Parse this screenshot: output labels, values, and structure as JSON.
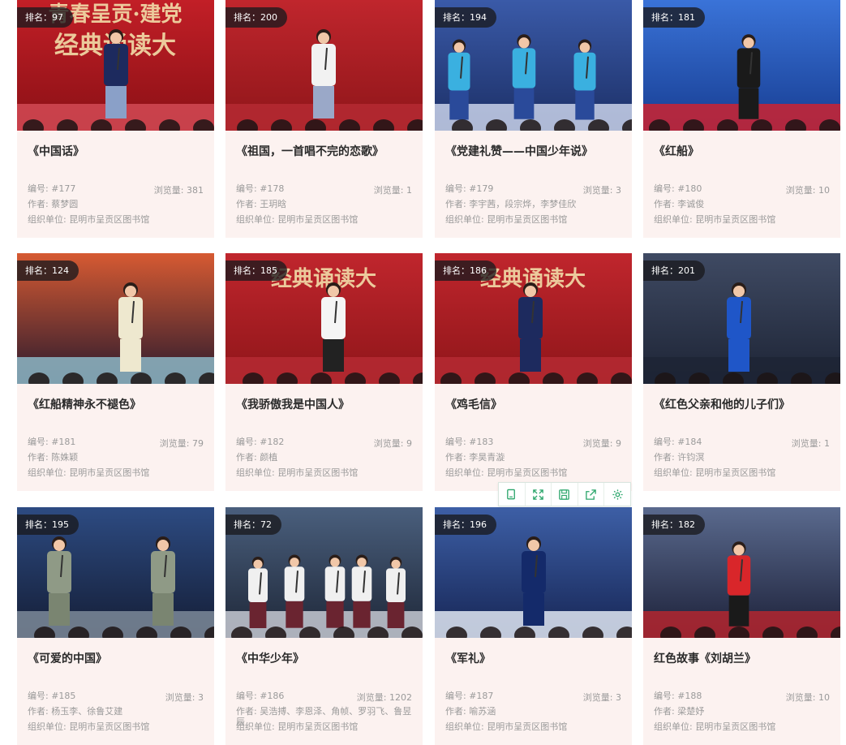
{
  "rank_prefix": "排名：",
  "labels": {
    "number": "编号: ",
    "views": "浏览量: ",
    "author": "作者: ",
    "org": "组织单位: "
  },
  "colors": {
    "card_bg": "#fcf2f0",
    "accent_green": "#2aa56a",
    "stage_red": "#c8242c"
  },
  "toolbar": [
    "copy-icon",
    "expand-icon",
    "save-icon",
    "share-icon",
    "gear-icon"
  ],
  "cards": [
    {
      "rank": "97",
      "title": "《中国话》",
      "number": "#177",
      "views": "381",
      "author": "蔡梦圆",
      "org": "昆明市呈贡区图书馆",
      "backdrop_text": "青春呈贡·建党",
      "backdrop_text2": "经典诵读大"
    },
    {
      "rank": "200",
      "title": "《祖国，一首唱不完的恋歌》",
      "number": "#178",
      "views": "1",
      "author": "王玥晗",
      "org": "昆明市呈贡区图书馆",
      "backdrop_text": "",
      "backdrop_text2": ""
    },
    {
      "rank": "194",
      "title": "《党建礼赞——中国少年说》",
      "number": "#179",
      "views": "3",
      "author": "李宇茜，段宗烨，李梦佳欣",
      "org": "昆明市呈贡区图书馆",
      "backdrop_text": "",
      "backdrop_text2": ""
    },
    {
      "rank": "181",
      "title": "《红船》",
      "number": "#180",
      "views": "10",
      "author": "李诚俊",
      "org": "昆明市呈贡区图书馆",
      "backdrop_text": "",
      "backdrop_text2": ""
    },
    {
      "rank": "124",
      "title": "《红船精神永不褪色》",
      "number": "#181",
      "views": "79",
      "author": "陈姝颖",
      "org": "昆明市呈贡区图书馆",
      "backdrop_text": "",
      "backdrop_text2": ""
    },
    {
      "rank": "185",
      "title": "《我骄傲我是中国人》",
      "number": "#182",
      "views": "9",
      "author": "颜植",
      "org": "昆明市呈贡区图书馆",
      "backdrop_text": "经典诵读大",
      "backdrop_text2": ""
    },
    {
      "rank": "186",
      "title": "《鸡毛信》",
      "number": "#183",
      "views": "9",
      "author": "李昊青漩",
      "org": "昆明市呈贡区图书馆",
      "backdrop_text": "经典诵读大",
      "backdrop_text2": ""
    },
    {
      "rank": "201",
      "title": "《红色父亲和他的儿子们》",
      "number": "#184",
      "views": "1",
      "author": "许钧溟",
      "org": "昆明市呈贡区图书馆",
      "backdrop_text": "",
      "backdrop_text2": ""
    },
    {
      "rank": "195",
      "title": "《可爱的中国》",
      "number": "#185",
      "views": "3",
      "author": "杨玉李、徐鲁艾建",
      "org": "昆明市呈贡区图书馆",
      "backdrop_text": "",
      "backdrop_text2": ""
    },
    {
      "rank": "72",
      "title": "《中华少年》",
      "number": "#186",
      "views": "1202",
      "author": "吴浩搏、李恩泽、角帧、罗羽飞、鲁昱辰",
      "org": "昆明市呈贡区图书馆",
      "backdrop_text": "",
      "backdrop_text2": ""
    },
    {
      "rank": "196",
      "title": "《军礼》",
      "number": "#187",
      "views": "3",
      "author": "喻苏涵",
      "org": "昆明市呈贡区图书馆",
      "backdrop_text": "",
      "backdrop_text2": ""
    },
    {
      "rank": "182",
      "title": "红色故事《刘胡兰》",
      "number": "#188",
      "views": "10",
      "author": "梁楚妤",
      "org": "昆明市呈贡区图书馆",
      "backdrop_text": "",
      "backdrop_text2": ""
    }
  ]
}
